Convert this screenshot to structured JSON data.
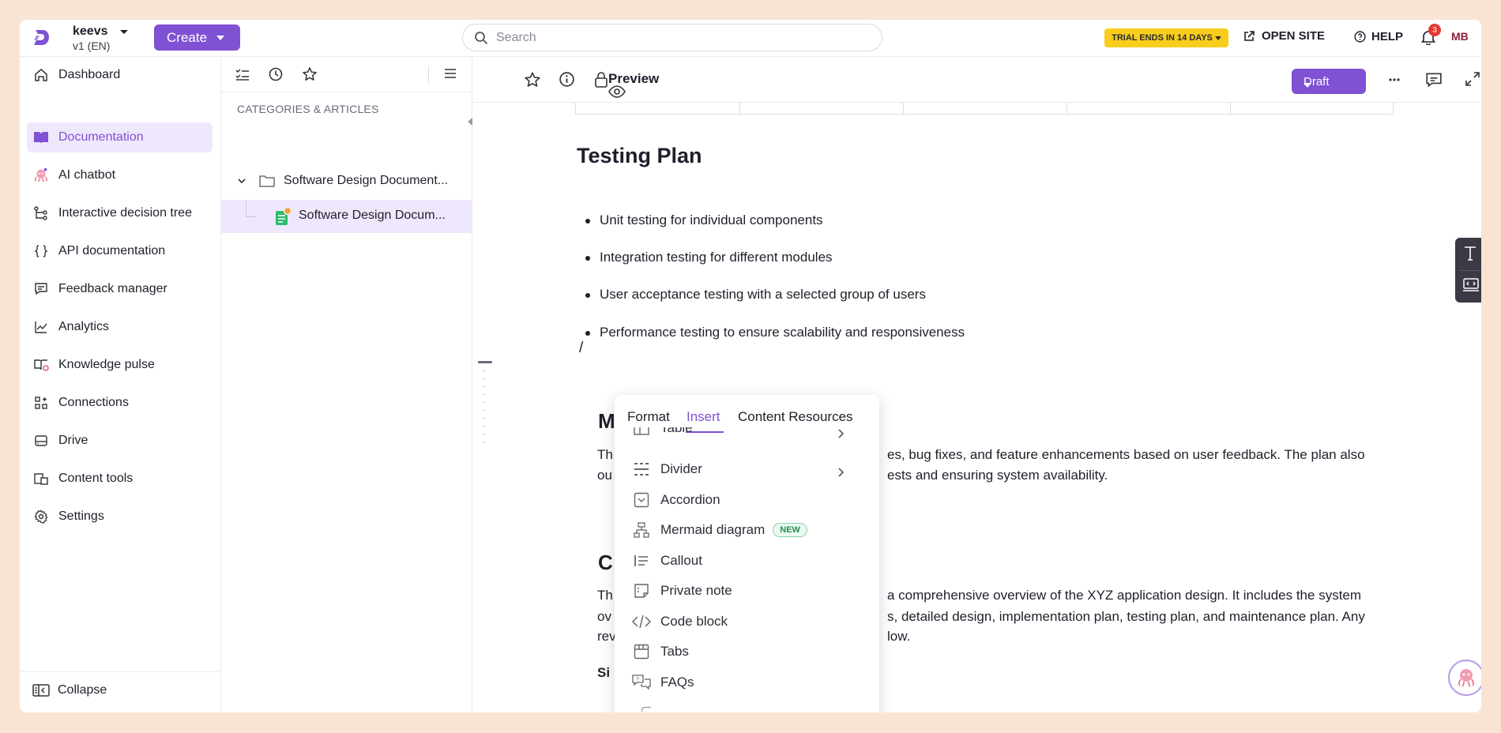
{
  "header": {
    "project_name": "keevs",
    "project_version": "v1 (EN)",
    "create_label": "Create",
    "search_placeholder": "Search",
    "trial_label": "TRIAL ENDS IN 14 DAYS",
    "open_site_label": "OPEN SITE",
    "help_label": "HELP",
    "notification_count": "3",
    "user_initials": "MB",
    "accent_color": "#7f51d3",
    "trial_color": "#f9cd1c"
  },
  "sidebar": {
    "items": [
      {
        "label": "Dashboard",
        "icon": "home-icon"
      },
      {
        "label": "Documentation",
        "icon": "book-icon",
        "active": true
      },
      {
        "label": "AI chatbot",
        "icon": "ai-bot-icon"
      },
      {
        "label": "Interactive decision tree",
        "icon": "tree-icon"
      },
      {
        "label": "API documentation",
        "icon": "braces-icon"
      },
      {
        "label": "Feedback manager",
        "icon": "feedback-icon"
      },
      {
        "label": "Analytics",
        "icon": "chart-icon"
      },
      {
        "label": "Knowledge pulse",
        "icon": "pulse-icon"
      },
      {
        "label": "Connections",
        "icon": "grid-plus-icon"
      },
      {
        "label": "Drive",
        "icon": "drive-icon"
      },
      {
        "label": "Content tools",
        "icon": "tools-icon"
      },
      {
        "label": "Settings",
        "icon": "gear-icon"
      }
    ],
    "collapse_label": "Collapse"
  },
  "tree": {
    "header": "CATEGORIES & ARTICLES",
    "category": "Software Design Document...",
    "article": "Software Design Docum..."
  },
  "editor": {
    "preview_label": "Preview",
    "draft_label": "Draft",
    "heading": "Testing Plan",
    "bullets": [
      "Unit testing for individual components",
      "Integration testing for different modules",
      "User acceptance testing with a selected group of users",
      "Performance testing to ensure scalability and responsiveness"
    ],
    "slash": "/",
    "heading_m": "M",
    "maint_line1_a": "Th",
    "maint_line1_b": "es, bug fixes, and feature enhancements based on user feedback. The plan also",
    "maint_line2_a": "ou",
    "maint_line2_b": "ests and ensuring system availability.",
    "heading_c": "C",
    "concl_line1_a": "Th",
    "concl_line1_b": "a comprehensive overview of the XYZ application design. It includes the system",
    "concl_line2_a": "ov",
    "concl_line2_b": "s, detailed design, implementation plan, testing plan, and maintenance plan. Any",
    "concl_line3_a": "rev",
    "concl_line3_b": "low.",
    "sig_fragment": "Si"
  },
  "insert_menu": {
    "tabs": [
      "Format",
      "Insert",
      "Content Resources"
    ],
    "active_tab": "Insert",
    "items": [
      {
        "label": "Table",
        "icon": "table-icon",
        "submenu": true
      },
      {
        "label": "Divider",
        "icon": "divider-icon",
        "submenu": true
      },
      {
        "label": "Accordion",
        "icon": "accordion-icon"
      },
      {
        "label": "Mermaid diagram",
        "icon": "mermaid-icon",
        "badge": "NEW"
      },
      {
        "label": "Callout",
        "icon": "callout-icon"
      },
      {
        "label": "Private note",
        "icon": "private-note-icon"
      },
      {
        "label": "Code block",
        "icon": "code-icon"
      },
      {
        "label": "Tabs",
        "icon": "tabs-icon"
      },
      {
        "label": "FAQs",
        "icon": "faq-icon"
      }
    ]
  }
}
